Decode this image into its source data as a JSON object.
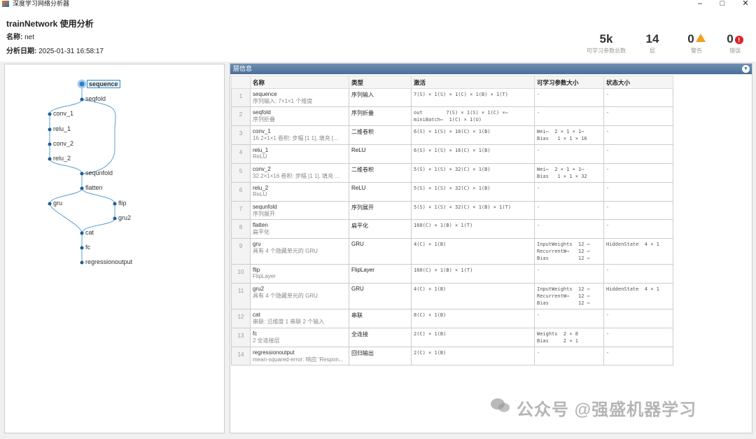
{
  "window": {
    "title": "深度学习网络分析器"
  },
  "header": {
    "title": "trainNetwork 使用分析",
    "name_label": "名称:",
    "name_value": "net",
    "date_label": "分析日期:",
    "date_value": "2025-01-31 16:58:17"
  },
  "stats": [
    {
      "value": "5k",
      "label": "可学习参数总数"
    },
    {
      "value": "14",
      "label": "层"
    },
    {
      "value": "0",
      "label": "警告",
      "icon": "warning-icon"
    },
    {
      "value": "0",
      "label": "错误",
      "icon": "error-icon"
    }
  ],
  "graph": {
    "nodes": [
      "sequence",
      "seqfold",
      "conv_1",
      "relu_1",
      "conv_2",
      "relu_2",
      "sequnfold",
      "flatten",
      "gru",
      "flip",
      "gru2",
      "cat",
      "fc",
      "regressionoutput"
    ],
    "selected": "sequence"
  },
  "table": {
    "panel_title": "层信息",
    "columns": [
      "名称",
      "类型",
      "激活",
      "可学习参数大小",
      "状态大小"
    ],
    "rows": [
      {
        "idx": "1",
        "name": "sequence",
        "desc": "序列输入: 7×1×1 个维度",
        "type": "序列输入",
        "act": "7(S) × 1(S) × 1(C) × 1(B) × 1(T)",
        "params": "-",
        "state": "-"
      },
      {
        "idx": "2",
        "name": "seqfold",
        "desc": "序列折叠",
        "type": "序列折叠",
        "act": "out        7(S) × 1(S) × 1(C) ×⋯\nminiBatch⋯  1(C) × 1(U)",
        "params": "-",
        "state": "-"
      },
      {
        "idx": "3",
        "name": "conv_1",
        "desc": "16 2×1×1 卷积: 步幅 [1 1], 填充 [...",
        "type": "二维卷积",
        "act": "6(S) × 1(S) × 16(C) × 1(B)",
        "params": "Wei⋯  2 × 1 × 1⋯\nBias   1 × 1 × 16",
        "state": "-"
      },
      {
        "idx": "4",
        "name": "relu_1",
        "desc": "ReLU",
        "type": "ReLU",
        "act": "6(S) × 1(S) × 16(C) × 1(B)",
        "params": "-",
        "state": "-"
      },
      {
        "idx": "5",
        "name": "conv_2",
        "desc": "32 2×1×16 卷积: 步幅 [1 1], 填充 ...",
        "type": "二维卷积",
        "act": "5(S) × 1(S) × 32(C) × 1(B)",
        "params": "Wei⋯  2 × 1 × 1⋯\nBias   1 × 1 × 32",
        "state": "-"
      },
      {
        "idx": "6",
        "name": "relu_2",
        "desc": "ReLU",
        "type": "ReLU",
        "act": "5(S) × 1(S) × 32(C) × 1(B)",
        "params": "-",
        "state": "-"
      },
      {
        "idx": "7",
        "name": "sequnfold",
        "desc": "序列展开",
        "type": "序列展开",
        "act": "5(S) × 1(S) × 32(C) × 1(B) × 1(T)",
        "params": "-",
        "state": "-"
      },
      {
        "idx": "8",
        "name": "flatten",
        "desc": "扁平化",
        "type": "扁平化",
        "act": "160(C) × 1(B) × 1(T)",
        "params": "-",
        "state": "-"
      },
      {
        "idx": "9",
        "name": "gru",
        "desc": "具有 4 个隐藏单元的 GRU",
        "type": "GRU",
        "act": "4(C) × 1(B)",
        "params": "InputWeights  12 ⋯\nRecurrentW⋯   12 ⋯\nBias          12 ⋯",
        "state": "HiddenState  4 × 1"
      },
      {
        "idx": "10",
        "name": "flip",
        "desc": "FlipLayer",
        "type": "FlipLayer",
        "act": "160(C) × 1(B) × 1(T)",
        "params": "-",
        "state": "-"
      },
      {
        "idx": "11",
        "name": "gru2",
        "desc": "具有 4 个隐藏单元的 GRU",
        "type": "GRU",
        "act": "4(C) × 1(B)",
        "params": "InputWeights  12 ⋯\nRecurrentW⋯   12 ⋯\nBias          12 ⋯",
        "state": "HiddenState  4 × 1"
      },
      {
        "idx": "12",
        "name": "cat",
        "desc": "串联: 沿维度 1 串联 2 个输入",
        "type": "串联",
        "act": "8(C) × 1(B)",
        "params": "-",
        "state": "-"
      },
      {
        "idx": "13",
        "name": "fc",
        "desc": "2 全连接层",
        "type": "全连接",
        "act": "2(C) × 1(B)",
        "params": "Weights  2 × 8\nBias     2 × 1",
        "state": "-"
      },
      {
        "idx": "14",
        "name": "regressionoutput",
        "desc": "mean-squared-error: 响应 'Respon...",
        "type": "回归输出",
        "act": "2(C) × 1(B)",
        "params": "-",
        "state": "-"
      }
    ]
  },
  "watermark": "公众号 @强盛机器学习"
}
